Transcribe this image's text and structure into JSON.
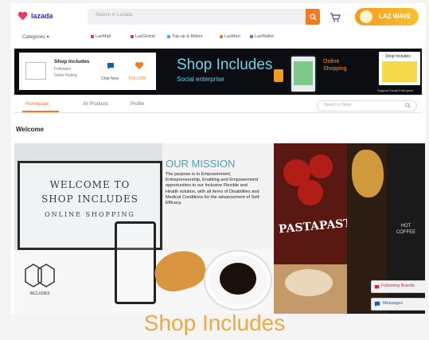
{
  "topbar": {
    "logo_text": "lazada",
    "search_placeholder": "Search in Lazada",
    "promo_text": "LAZ WAVE"
  },
  "categories": {
    "select_label": "Categories",
    "items": [
      {
        "label": "LazMall",
        "color": "#e6364b"
      },
      {
        "label": "LazGlobal",
        "color": "#e6364b"
      },
      {
        "label": "Top-up & Billers",
        "color": "#4aa6e0"
      },
      {
        "label": "LazMart",
        "color": "#f37a21"
      },
      {
        "label": "LazWallet",
        "color": "#9b59b6"
      }
    ]
  },
  "store": {
    "name": "Shop Includes",
    "followers": "Followers",
    "rating": "Seller Rating",
    "chat_label": "Chat Now",
    "follow_label": "FOLLOW"
  },
  "banner": {
    "title": "Shop Includes",
    "subtitle": "Social enterprise",
    "online_label_line1": "Online",
    "online_label_line2": "Shopping",
    "thumb_title": "Shop Includes",
    "thumb_caption": "Support Social Enterprise"
  },
  "tabs": {
    "items": [
      "Homepage",
      "All Products",
      "Profile"
    ],
    "search_placeholder": "Search in Store"
  },
  "welcome_heading": "Welcome",
  "hero": {
    "welcome_line1": "WELCOME TO",
    "welcome_line2": "SHOP INCLUDES",
    "welcome_line3": "ONLINE SHOPPING",
    "mission_title": "OUR MISSION",
    "mission_text": "The purpose is to Empowerment, Entrepreneurship, Enabling and Empowerment opportunities to our Inclusive Flexible and Health solution, with all items of Disabilities and Medical Conditions for the advancement of Self-Efficacy.",
    "pasta_text": "PASTAPASTA",
    "coffee_text_line1": "HOT",
    "coffee_text_line2": "COFFEE",
    "logo_caption": "INCLUDES"
  },
  "floating": {
    "follow_label": "Following Brands",
    "messages_label": "Messages"
  },
  "caption": "Shop Includes"
}
